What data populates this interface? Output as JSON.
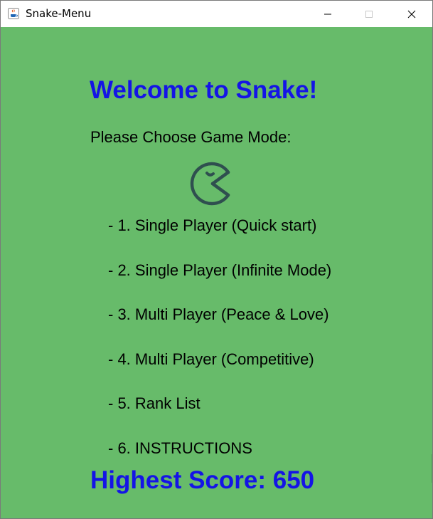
{
  "window": {
    "title": "Snake-Menu",
    "icon": "java-cup-icon"
  },
  "colors": {
    "background": "#67bb6a",
    "heading": "#1414e6",
    "text": "#000000",
    "pacman_stroke": "#2f4f4f"
  },
  "menu": {
    "welcome": "Welcome to Snake!",
    "prompt": "Please Choose Game Mode:",
    "mascot_icon": "pacman-icon",
    "items": [
      {
        "label": "- 1. Single Player (Quick start)"
      },
      {
        "label": "- 2. Single Player (Infinite Mode)"
      },
      {
        "label": "- 3. Multi Player (Peace & Love)"
      },
      {
        "label": "- 4. Multi Player (Competitive)"
      },
      {
        "label": "- 5. Rank List"
      },
      {
        "label": "- 6. INSTRUCTIONS"
      }
    ],
    "highest_score": "Highest Score: 650"
  }
}
